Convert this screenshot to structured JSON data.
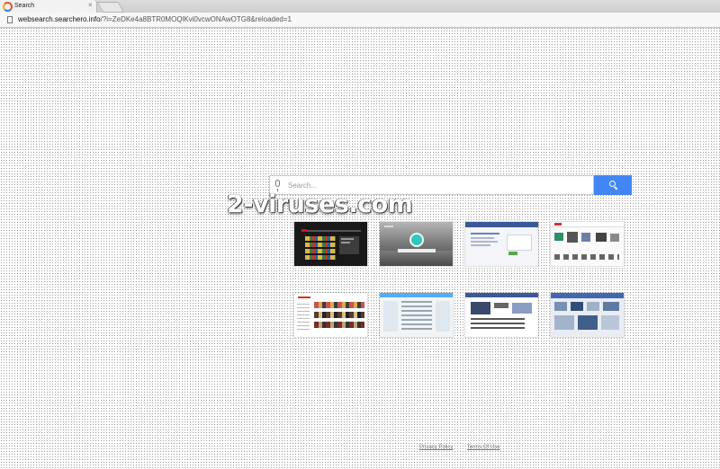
{
  "browser": {
    "tab_title": "Search",
    "tab_close": "×",
    "url_host": "websearch.searchero.info",
    "url_rest": "/?i=ZeDKe4a8BTR0MOQlKvi0vcwONAwOTG8&reloaded=1"
  },
  "search": {
    "placeholder": "Search...",
    "accent_color": "#4285f4"
  },
  "watermark": "2-viruses.com",
  "footer": {
    "privacy_label": "Privacy Policy",
    "terms_label": "Terms Of Use"
  }
}
